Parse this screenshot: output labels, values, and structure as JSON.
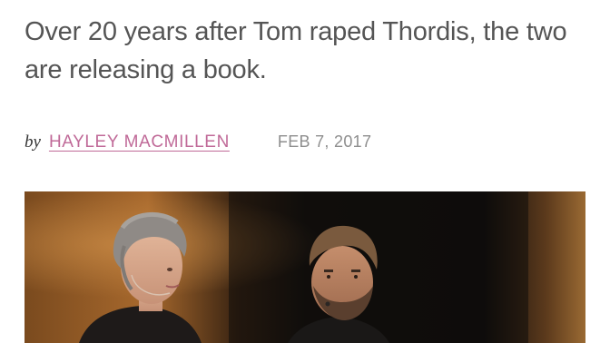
{
  "article": {
    "subheadline": "Over 20 years after Tom raped Thordis, the two are releasing a book.",
    "byline": {
      "prefix": "by",
      "author": "HAYLEY MACMILLEN",
      "date": "FEB 7, 2017"
    }
  },
  "colors": {
    "text": "#555555",
    "author_link": "#c06a98",
    "date": "#8e8e8e"
  },
  "icons": []
}
